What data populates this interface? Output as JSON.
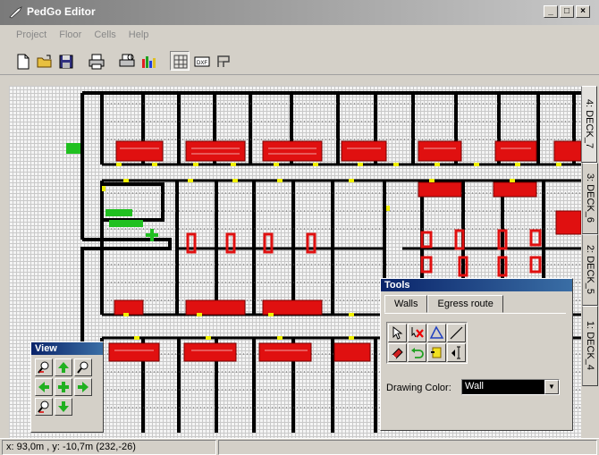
{
  "window": {
    "title": "PedGo Editor",
    "minimize": "_",
    "maximize": "□",
    "close": "×"
  },
  "menu": [
    "Project",
    "Floor",
    "Cells",
    "Help"
  ],
  "toolbar": {
    "icons": [
      "new-file-icon",
      "open-folder-icon",
      "save-icon",
      "print-icon",
      "print-preview-icon",
      "color-chart-icon",
      "grid-icon",
      "dxf-icon",
      "route-icon"
    ],
    "dxf_label": "DXF"
  },
  "decks": [
    "4: DECK_7",
    "3: DECK_6",
    "2: DECK_5",
    "1: DECK_4"
  ],
  "active_deck": "4: DECK_7",
  "view_palette": {
    "title": "View"
  },
  "tools_palette": {
    "title": "Tools",
    "tabs": [
      "Walls",
      "Egress route"
    ],
    "active_tab": "Walls",
    "drawing_color_label": "Drawing Color:",
    "drawing_color_value": "Wall",
    "tool_icons": [
      "select-pointer-icon",
      "delete-icon",
      "polygon-icon",
      "line-icon",
      "eraser-icon",
      "undo-icon",
      "door-tool-icon",
      "measure-tool-icon"
    ]
  },
  "status": {
    "coords": "x: 93,0m , y: -10,7m (232,-26)"
  },
  "colors": {
    "wall": "#000000",
    "room": "#e01010",
    "door": "#f0f000",
    "marker": "#20c020",
    "grid": "#c9c9c9"
  }
}
